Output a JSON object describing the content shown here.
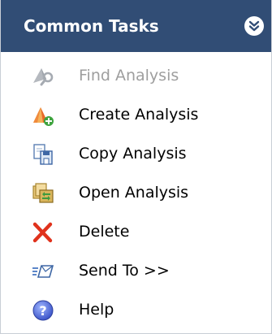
{
  "panel": {
    "title": "Common Tasks",
    "collapse_icon": "double-chevron-down-icon",
    "colors": {
      "header_bg": "#314d75",
      "header_text": "#ffffff",
      "disabled_text": "#9e9e9e"
    }
  },
  "tasks": [
    {
      "label": "Find Analysis",
      "icon": "find-analysis-icon",
      "enabled": false
    },
    {
      "label": "Create Analysis",
      "icon": "create-analysis-icon",
      "enabled": true
    },
    {
      "label": "Copy Analysis",
      "icon": "copy-analysis-icon",
      "enabled": true
    },
    {
      "label": "Open Analysis",
      "icon": "open-analysis-icon",
      "enabled": true
    },
    {
      "label": "Delete",
      "icon": "delete-icon",
      "enabled": true
    },
    {
      "label": "Send To >>",
      "icon": "send-to-icon",
      "enabled": true
    },
    {
      "label": "Help",
      "icon": "help-icon",
      "enabled": true
    }
  ]
}
